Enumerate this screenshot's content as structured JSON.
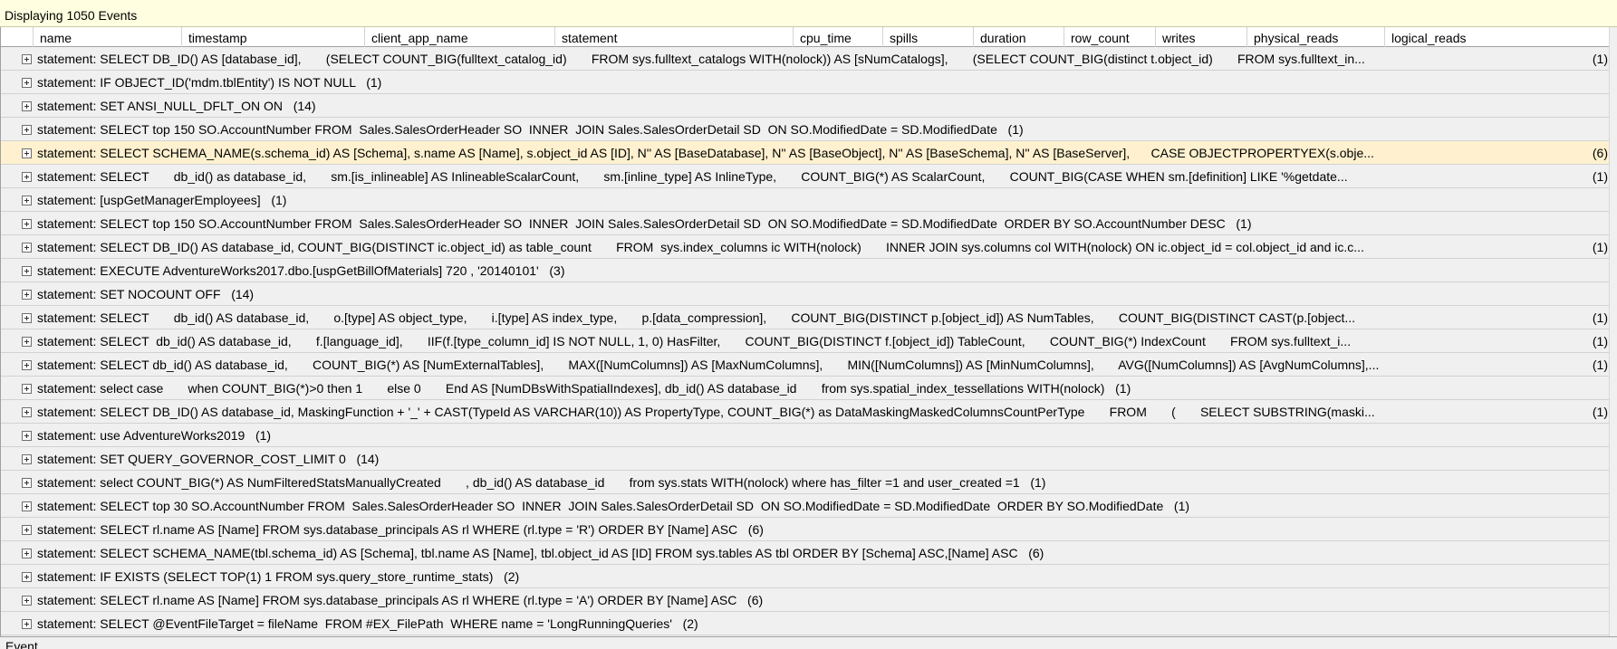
{
  "status": {
    "text": "Displaying 1050 Events"
  },
  "columns": [
    {
      "label": "name"
    },
    {
      "label": "timestamp"
    },
    {
      "label": "client_app_name"
    },
    {
      "label": "statement"
    },
    {
      "label": "cpu_time"
    },
    {
      "label": "spills"
    },
    {
      "label": "duration"
    },
    {
      "label": "row_count"
    },
    {
      "label": "writes"
    },
    {
      "label": "physical_reads"
    },
    {
      "label": "logical_reads"
    }
  ],
  "rows": [
    {
      "text": "statement: SELECT DB_ID() AS [database_id],       (SELECT COUNT_BIG(fulltext_catalog_id)       FROM sys.fulltext_catalogs WITH(nolock)) AS [sNumCatalogs],       (SELECT COUNT_BIG(distinct t.object_id)       FROM sys.fulltext_in...",
      "count": "(1)",
      "highlighted": false,
      "truncated": true
    },
    {
      "text": "statement: IF OBJECT_ID('mdm.tblEntity') IS NOT NULL   (1)",
      "count": "",
      "highlighted": false,
      "truncated": false
    },
    {
      "text": "statement: SET ANSI_NULL_DFLT_ON ON   (14)",
      "count": "",
      "highlighted": false,
      "truncated": false
    },
    {
      "text": "statement: SELECT top 150 SO.AccountNumber FROM  Sales.SalesOrderHeader SO  INNER  JOIN Sales.SalesOrderDetail SD  ON SO.ModifiedDate = SD.ModifiedDate   (1)",
      "count": "",
      "highlighted": false,
      "truncated": false
    },
    {
      "text": "statement: SELECT SCHEMA_NAME(s.schema_id) AS [Schema], s.name AS [Name], s.object_id AS [ID], N'' AS [BaseDatabase], N'' AS [BaseObject], N'' AS [BaseSchema], N'' AS [BaseServer],      CASE OBJECTPROPERTYEX(s.obje...",
      "count": "(6)",
      "highlighted": true,
      "truncated": true
    },
    {
      "text": "statement: SELECT       db_id() as database_id,       sm.[is_inlineable] AS InlineableScalarCount,       sm.[inline_type] AS InlineType,       COUNT_BIG(*) AS ScalarCount,       COUNT_BIG(CASE WHEN sm.[definition] LIKE '%getdate...",
      "count": "(1)",
      "highlighted": false,
      "truncated": true
    },
    {
      "text": "statement: [uspGetManagerEmployees]   (1)",
      "count": "",
      "highlighted": false,
      "truncated": false
    },
    {
      "text": "statement: SELECT top 150 SO.AccountNumber FROM  Sales.SalesOrderHeader SO  INNER  JOIN Sales.SalesOrderDetail SD  ON SO.ModifiedDate = SD.ModifiedDate  ORDER BY SO.AccountNumber DESC   (1)",
      "count": "",
      "highlighted": false,
      "truncated": false
    },
    {
      "text": "statement: SELECT DB_ID() AS database_id, COUNT_BIG(DISTINCT ic.object_id) as table_count       FROM  sys.index_columns ic WITH(nolock)       INNER JOIN sys.columns col WITH(nolock) ON ic.object_id = col.object_id and ic.c...",
      "count": "(1)",
      "highlighted": false,
      "truncated": true
    },
    {
      "text": "statement: EXECUTE AdventureWorks2017.dbo.[uspGetBillOfMaterials] 720 , '20140101'   (3)",
      "count": "",
      "highlighted": false,
      "truncated": false
    },
    {
      "text": "statement: SET NOCOUNT OFF   (14)",
      "count": "",
      "highlighted": false,
      "truncated": false
    },
    {
      "text": "statement: SELECT       db_id() AS database_id,       o.[type] AS object_type,       i.[type] AS index_type,       p.[data_compression],       COUNT_BIG(DISTINCT p.[object_id]) AS NumTables,       COUNT_BIG(DISTINCT CAST(p.[object...",
      "count": "(1)",
      "highlighted": false,
      "truncated": true
    },
    {
      "text": "statement: SELECT  db_id() AS database_id,       f.[language_id],       IIF(f.[type_column_id] IS NOT NULL, 1, 0) HasFilter,       COUNT_BIG(DISTINCT f.[object_id]) TableCount,       COUNT_BIG(*) IndexCount       FROM sys.fulltext_i...",
      "count": "(1)",
      "highlighted": false,
      "truncated": true
    },
    {
      "text": "statement: SELECT db_id() AS database_id,       COUNT_BIG(*) AS [NumExternalTables],       MAX([NumColumns]) AS [MaxNumColumns],       MIN([NumColumns]) AS [MinNumColumns],       AVG([NumColumns]) AS [AvgNumColumns],...",
      "count": "(1)",
      "highlighted": false,
      "truncated": true
    },
    {
      "text": "statement: select case       when COUNT_BIG(*)>0 then 1       else 0       End AS [NumDBsWithSpatialIndexes], db_id() AS database_id       from sys.spatial_index_tessellations WITH(nolock)   (1)",
      "count": "",
      "highlighted": false,
      "truncated": false
    },
    {
      "text": "statement: SELECT DB_ID() AS database_id, MaskingFunction + '_' + CAST(TypeId AS VARCHAR(10)) AS PropertyType, COUNT_BIG(*) as DataMaskingMaskedColumnsCountPerType       FROM       (       SELECT SUBSTRING(maski...",
      "count": "(1)",
      "highlighted": false,
      "truncated": true
    },
    {
      "text": "statement: use AdventureWorks2019   (1)",
      "count": "",
      "highlighted": false,
      "truncated": false
    },
    {
      "text": "statement: SET QUERY_GOVERNOR_COST_LIMIT 0   (14)",
      "count": "",
      "highlighted": false,
      "truncated": false
    },
    {
      "text": "statement: select COUNT_BIG(*) AS NumFilteredStatsManuallyCreated       , db_id() AS database_id       from sys.stats WITH(nolock) where has_filter =1 and user_created =1   (1)",
      "count": "",
      "highlighted": false,
      "truncated": false
    },
    {
      "text": "statement: SELECT top 30 SO.AccountNumber FROM  Sales.SalesOrderHeader SO  INNER  JOIN Sales.SalesOrderDetail SD  ON SO.ModifiedDate = SD.ModifiedDate  ORDER BY SO.ModifiedDate   (1)",
      "count": "",
      "highlighted": false,
      "truncated": false
    },
    {
      "text": "statement: SELECT rl.name AS [Name] FROM sys.database_principals AS rl WHERE (rl.type = 'R') ORDER BY [Name] ASC   (6)",
      "count": "",
      "highlighted": false,
      "truncated": false
    },
    {
      "text": "statement: SELECT SCHEMA_NAME(tbl.schema_id) AS [Schema], tbl.name AS [Name], tbl.object_id AS [ID] FROM sys.tables AS tbl ORDER BY [Schema] ASC,[Name] ASC   (6)",
      "count": "",
      "highlighted": false,
      "truncated": false
    },
    {
      "text": "statement: IF EXISTS (SELECT TOP(1) 1 FROM sys.query_store_runtime_stats)   (2)",
      "count": "",
      "highlighted": false,
      "truncated": false
    },
    {
      "text": "statement: SELECT rl.name AS [Name] FROM sys.database_principals AS rl WHERE (rl.type = 'A') ORDER BY [Name] ASC   (6)",
      "count": "",
      "highlighted": false,
      "truncated": false
    },
    {
      "text": "statement: SELECT @EventFileTarget = fileName  FROM #EX_FilePath  WHERE name = 'LongRunningQueries'   (2)",
      "count": "",
      "highlighted": false,
      "truncated": false
    }
  ],
  "footer": {
    "tab_label": "Event"
  },
  "colors": {
    "status_bg": "#fffee0",
    "highlight_row": "#fff1cf",
    "grid_bg": "#f0f0f0"
  }
}
